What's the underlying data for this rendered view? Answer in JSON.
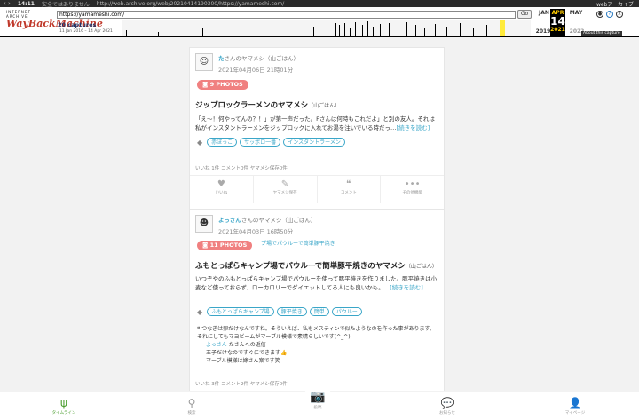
{
  "browser": {
    "time": "14:11",
    "security": "安全ではありません",
    "url": "http://web.archive.org/web/20210414190300/https://yamameshi.com/",
    "tab_title": "webアーカイブ"
  },
  "wayback": {
    "logo_small": "INTERNET ARCHIVE",
    "logo_big": "WayBackMachine",
    "url_value": "https://yamameshi.com/",
    "go_label": "Go",
    "captures": "20 captures",
    "range": "11 Jan 2016 – 14 Apr 2021",
    "prev_month": "JAN",
    "cur_month": "APR",
    "next_month": "MAY",
    "cur_day": "14",
    "prev_year": "2019",
    "cur_year": "2021",
    "next_year": "2022",
    "about": "About this capture"
  },
  "posts": [
    {
      "author": "た",
      "author_suffix": "さんのヤマメシ（山ごはん）",
      "date": "2021年04月06日 21時01分",
      "photos": "9 PHOTOS",
      "img_alt": "イン",
      "title": "ジップロックラーメンのヤマメシ",
      "title_sub": "（山ごはん）",
      "body": "「え～！何やってんの？！」が第一声だった。Fさんは何時もこれだよ」と別の友人。それは私がインスタントラーメンをジップロックに入れてお湯を注いでいる時だっ…",
      "more": "[続きを読む]",
      "tags": [
        "赤ぼっこ",
        "サッポロ一番",
        "インスタントラーメン"
      ],
      "stats": "いいね 1件  コメント0件  ヤマメシ保存0件"
    },
    {
      "author": "よっさん",
      "author_suffix": "さんのヤマメシ（山ごはん）",
      "date": "2021年04月03日 16時50分",
      "photos": "11 PHOTOS",
      "img_alt": "プ場でパウルーで簡単豚平焼き",
      "title": "ふもとっぱらキャンプ場でパウルーで簡単豚平焼きのヤマメシ",
      "title_sub": "（山ごはん）",
      "body": "いつぞやのふもとっぱらキャンプ場でパウルーを使って豚平焼きを作りました。豚平焼きは小麦など使っておらず、ローカロリーでダイエットしてる人にも良いかも。…",
      "more": "[続きを読む]",
      "tags": [
        "ふもとっぱらキャンプ場",
        "豚平焼き",
        "簡単",
        "パウルー"
      ],
      "comment1": "つなぎは卵だけなんですね。そういえば、私もメスティンで似たようなのを作った事があります。それにしてもマヨビームがマーブル模様で素晴らしいです(^_^)",
      "comment1_author": "よっさん",
      "comment1_reply_to": "たさんへの返信",
      "comment2a": "玉子だけなのですぐにできます👍",
      "comment2b": "マーブル模様は嫁さん案です笑",
      "stats": "いいね 3件  コメント2件  ヤマメシ保存0件"
    }
  ],
  "actions": [
    "いいね",
    "ヤマメシ保存",
    "コメント",
    "その他機能"
  ],
  "bottom_nav": [
    "タイムライン",
    "検索",
    "投稿",
    "お知らせ",
    "マイページ"
  ]
}
